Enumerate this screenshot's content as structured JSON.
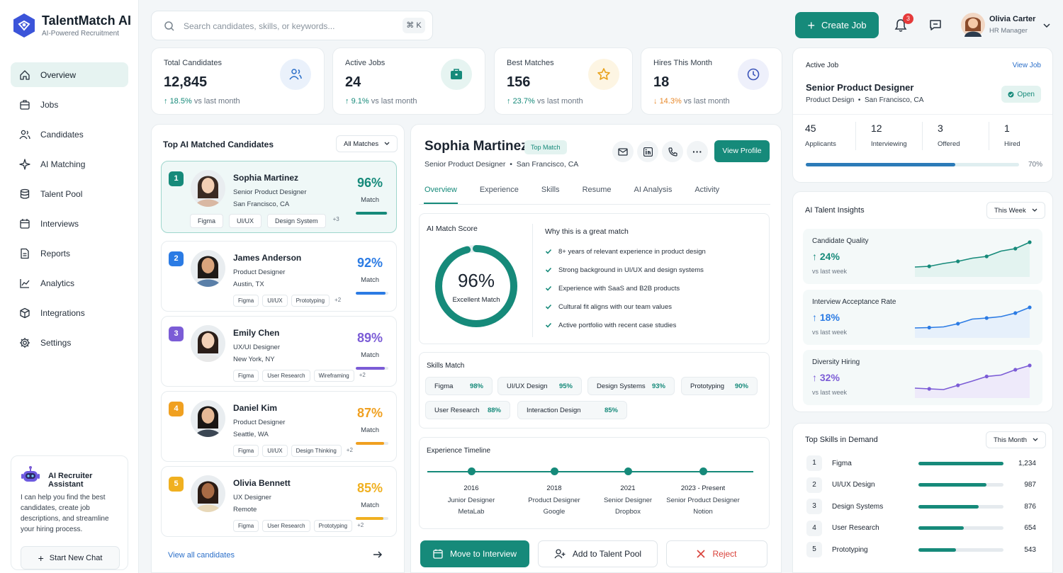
{
  "brand": {
    "name": "TalentMatch AI",
    "tagline": "AI-Powered Recruitment"
  },
  "nav": [
    {
      "label": "Overview",
      "icon": "home-icon",
      "active": true
    },
    {
      "label": "Jobs",
      "icon": "briefcase-icon"
    },
    {
      "label": "Candidates",
      "icon": "users-icon"
    },
    {
      "label": "AI Matching",
      "icon": "sparkle-icon"
    },
    {
      "label": "Talent Pool",
      "icon": "database-icon"
    },
    {
      "label": "Interviews",
      "icon": "calendar-icon"
    },
    {
      "label": "Reports",
      "icon": "file-icon"
    },
    {
      "label": "Analytics",
      "icon": "chart-icon"
    },
    {
      "label": "Integrations",
      "icon": "cube-icon"
    },
    {
      "label": "Settings",
      "icon": "gear-icon"
    }
  ],
  "assistant": {
    "title": "AI Recruiter Assistant",
    "text": "I can help you find the best candidates, create job descriptions, and streamline your hiring process.",
    "button": "Start New Chat"
  },
  "search": {
    "placeholder": "Search candidates, skills, or keywords...",
    "shortcut": "⌘ K"
  },
  "header": {
    "create_label": "Create Job",
    "notifications": "3",
    "user_name": "Olivia Carter",
    "user_role": "HR Manager"
  },
  "stats": [
    {
      "label": "Total Candidates",
      "value": "12,845",
      "change": "18.5%",
      "suffix": "vs last month",
      "dir": "up"
    },
    {
      "label": "Active Jobs",
      "value": "24",
      "change": "9.1%",
      "suffix": "vs last month",
      "dir": "up"
    },
    {
      "label": "Best Matches",
      "value": "156",
      "change": "23.7%",
      "suffix": "vs last month",
      "dir": "up"
    },
    {
      "label": "Hires This Month",
      "value": "18",
      "change": "14.3%",
      "suffix": "vs last month",
      "dir": "down"
    }
  ],
  "candidates_panel": {
    "title": "Top AI Matched Candidates",
    "filter": "All Matches",
    "view_all": "View all candidates",
    "match_label": "Match"
  },
  "candidates": [
    {
      "rank": "1",
      "name": "Sophia Martinez",
      "role": "Senior Product Designer",
      "location": "San Francisco, CA",
      "tags": [
        "Figma",
        "UI/UX",
        "Design System"
      ],
      "more": "+3",
      "match": "96%",
      "match_value": 96,
      "color": "#168a7a"
    },
    {
      "rank": "2",
      "name": "James Anderson",
      "role": "Product Designer",
      "location": "Austin, TX",
      "tags": [
        "Figma",
        "UI/UX",
        "Prototyping"
      ],
      "more": "+2",
      "match": "92%",
      "match_value": 92,
      "color": "#2b7be4"
    },
    {
      "rank": "3",
      "name": "Emily Chen",
      "role": "UX/UI Designer",
      "location": "New York, NY",
      "tags": [
        "Figma",
        "User Research",
        "Wireframing"
      ],
      "more": "+2",
      "match": "89%",
      "match_value": 89,
      "color": "#7b5cd6"
    },
    {
      "rank": "4",
      "name": "Daniel Kim",
      "role": "Product Designer",
      "location": "Seattle, WA",
      "tags": [
        "Figma",
        "UI/UX",
        "Design Thinking"
      ],
      "more": "+2",
      "match": "87%",
      "match_value": 87,
      "color": "#f0a020"
    },
    {
      "rank": "5",
      "name": "Olivia Bennett",
      "role": "UX Designer",
      "location": "Remote",
      "tags": [
        "Figma",
        "User Research",
        "Prototyping"
      ],
      "more": "+2",
      "match": "85%",
      "match_value": 85,
      "color": "#f0b020"
    }
  ],
  "detail": {
    "name": "Sophia Martinez",
    "badge": "Top Match",
    "role": "Senior Product Designer",
    "location": "San Francisco, CA",
    "view_profile": "View Profile",
    "tabs": [
      "Overview",
      "Experience",
      "Skills",
      "Resume",
      "AI Analysis",
      "Activity"
    ],
    "score_title": "AI Match Score",
    "score": "96%",
    "score_value": 96,
    "score_caption": "Excellent Match",
    "why_title": "Why this is a great match",
    "reasons": [
      "8+ years of relevant experience in product design",
      "Strong background in UI/UX and design systems",
      "Experience with SaaS and B2B products",
      "Cultural fit aligns with our team values",
      "Active portfolio with recent case studies"
    ],
    "skills_title": "Skills Match",
    "skills": [
      {
        "name": "Figma",
        "pct": "98%"
      },
      {
        "name": "UI/UX Design",
        "pct": "95%"
      },
      {
        "name": "Design Systems",
        "pct": "93%"
      },
      {
        "name": "Prototyping",
        "pct": "90%"
      },
      {
        "name": "User Research",
        "pct": "88%"
      },
      {
        "name": "Interaction Design",
        "pct": "85%"
      }
    ],
    "timeline_title": "Experience Timeline",
    "timeline": [
      {
        "year": "2016",
        "role": "Junior Designer",
        "company": "MetaLab"
      },
      {
        "year": "2018",
        "role": "Product Designer",
        "company": "Google"
      },
      {
        "year": "2021",
        "role": "Senior Designer",
        "company": "Dropbox"
      },
      {
        "year": "2023 - Present",
        "role": "Senior Product Designer",
        "company": "Notion"
      }
    ],
    "actions": {
      "interview": "Move to Interview",
      "pool": "Add to Talent Pool",
      "reject": "Reject"
    }
  },
  "active_job": {
    "title": "Active Job",
    "link": "View Job",
    "job": "Senior Product Designer",
    "dept": "Product Design",
    "location": "San Francisco, CA",
    "status": "Open",
    "metrics": [
      {
        "value": "45",
        "label": "Applicants"
      },
      {
        "value": "12",
        "label": "Interviewing"
      },
      {
        "value": "3",
        "label": "Offered"
      },
      {
        "value": "1",
        "label": "Hired"
      }
    ],
    "progress": "70%",
    "progress_value": 70
  },
  "insights": {
    "title": "AI Talent Insights",
    "filter": "This Week",
    "items": [
      {
        "label": "Candidate Quality",
        "value": "24%",
        "sub": "vs last week",
        "color": "#168a7a",
        "fill": "#dff1ee",
        "points": [
          2,
          2.2,
          3,
          3.6,
          4.5,
          5,
          6.5,
          7.2,
          9
        ]
      },
      {
        "label": "Interview Acceptance Rate",
        "value": "18%",
        "sub": "vs last week",
        "color": "#2b7be4",
        "fill": "#e2edfb",
        "points": [
          2,
          2.1,
          2.3,
          3.2,
          4.5,
          4.8,
          5.2,
          6.2,
          7.8
        ]
      },
      {
        "label": "Diversity Hiring",
        "value": "32%",
        "sub": "vs last week",
        "color": "#7b5cd6",
        "fill": "#ece6fa",
        "points": [
          2,
          1.8,
          1.6,
          2.8,
          4,
          5.3,
          5.7,
          7.2,
          8.4
        ]
      }
    ]
  },
  "top_skills": {
    "title": "Top Skills in Demand",
    "filter": "This Month",
    "items": [
      {
        "rank": "1",
        "name": "Figma",
        "count": "1,234",
        "value": 1234
      },
      {
        "rank": "2",
        "name": "UI/UX Design",
        "count": "987",
        "value": 987
      },
      {
        "rank": "3",
        "name": "Design Systems",
        "count": "876",
        "value": 876
      },
      {
        "rank": "4",
        "name": "User Research",
        "count": "654",
        "value": 654
      },
      {
        "rank": "5",
        "name": "Prototyping",
        "count": "543",
        "value": 543
      }
    ]
  }
}
